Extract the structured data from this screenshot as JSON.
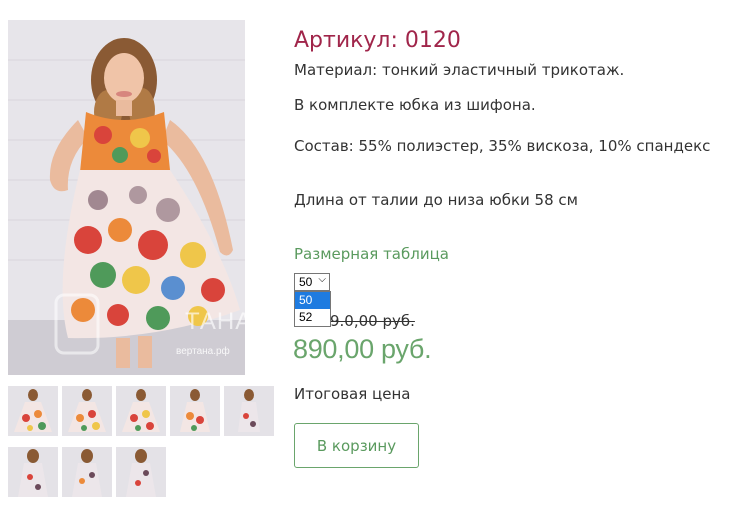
{
  "product": {
    "sku_label": "Артикул: 0120",
    "material": "Материал: тонкий эластичный трикотаж.",
    "set_note": "В комплекте юбка из шифона.",
    "composition": "Состав: 55% полиэстер, 35% вискоза, 10% спандекс",
    "length": "Длина от талии до низа юбки 58 см",
    "size_chart_link": "Размерная таблица",
    "size_select": {
      "selected": "50",
      "options": [
        "50",
        "52"
      ]
    },
    "old_price": "9.0,00 руб.",
    "price": "890,00 руб.",
    "final_price_label": "Итоговая цена",
    "cart_button": "В корзину"
  },
  "watermark": {
    "brand": "ТАНА",
    "site": "вертана.рф"
  },
  "gallery": {
    "thumbnail_count": 8,
    "colors": {
      "dress_red": "#d9443b",
      "dress_orange": "#ec8a3a",
      "dress_yellow": "#efc64a",
      "leaf_green": "#4f9a5a",
      "leopard": "#6b4a5a"
    }
  }
}
